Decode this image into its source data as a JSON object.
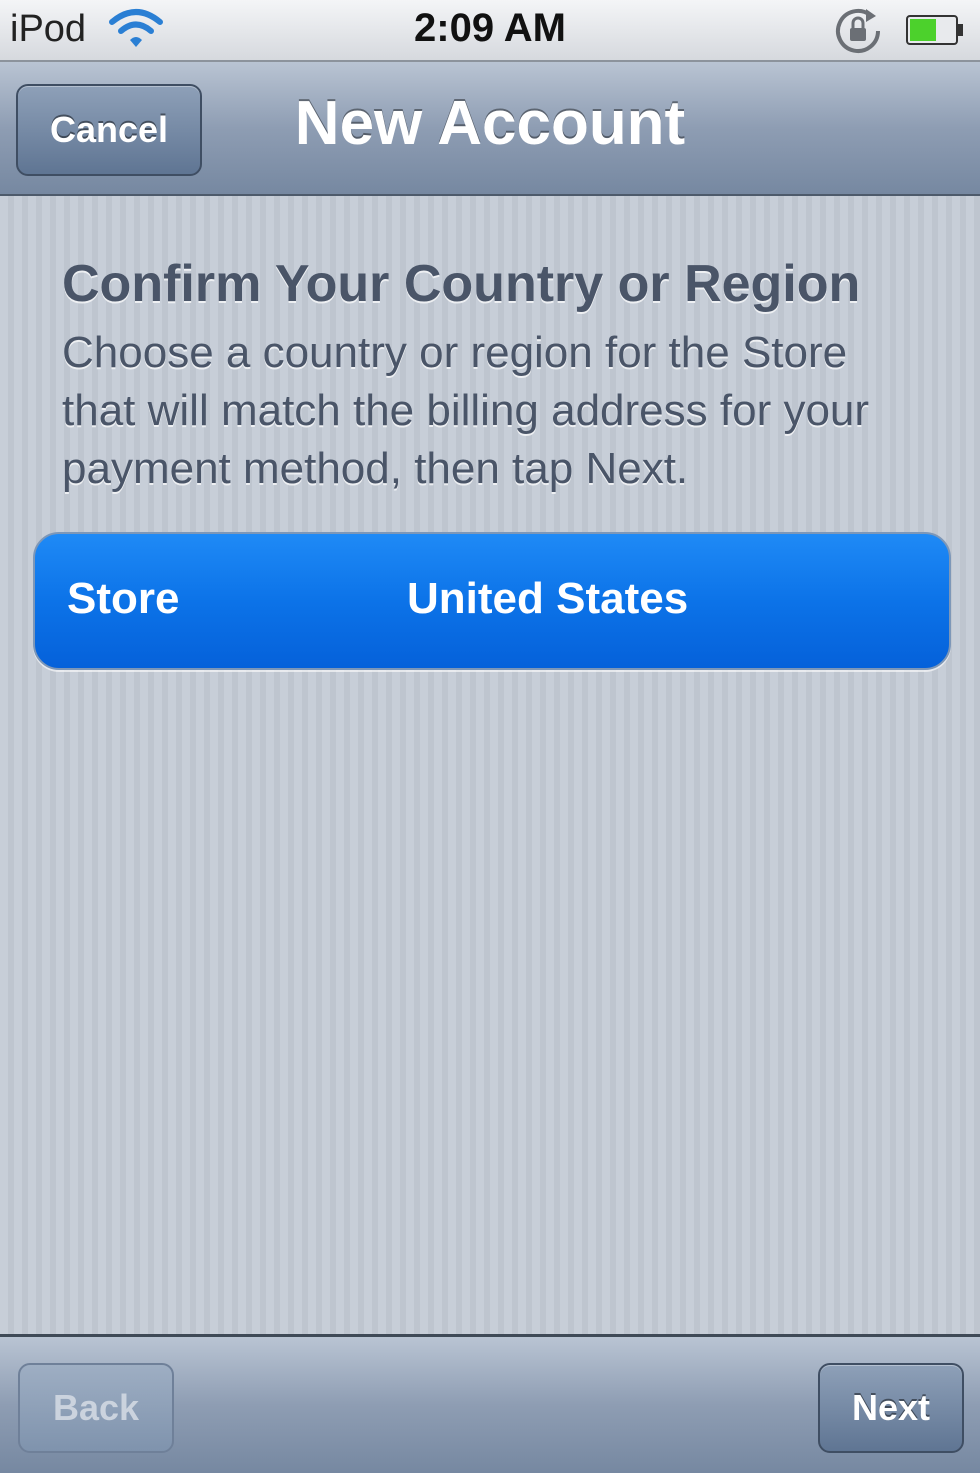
{
  "status_bar": {
    "carrier": "iPod",
    "time": "2:09 AM",
    "icons": [
      "wifi-icon",
      "rotation-lock-icon",
      "battery-icon"
    ]
  },
  "nav_bar": {
    "cancel_label": "Cancel",
    "title": "New Account"
  },
  "content": {
    "section_title": "Confirm Your Country or Region",
    "description": "Choose a country or region for the Store that will match the billing address for your payment method, then tap Next.",
    "store_row": {
      "label": "Store",
      "value": "United States"
    }
  },
  "toolbar": {
    "back_label": "Back",
    "next_label": "Next"
  },
  "colors": {
    "selected_row": "#0c73e8",
    "nav_bar": "#8e9db3",
    "background": "#c5ccd6",
    "battery_fill": "#4cd12c"
  }
}
